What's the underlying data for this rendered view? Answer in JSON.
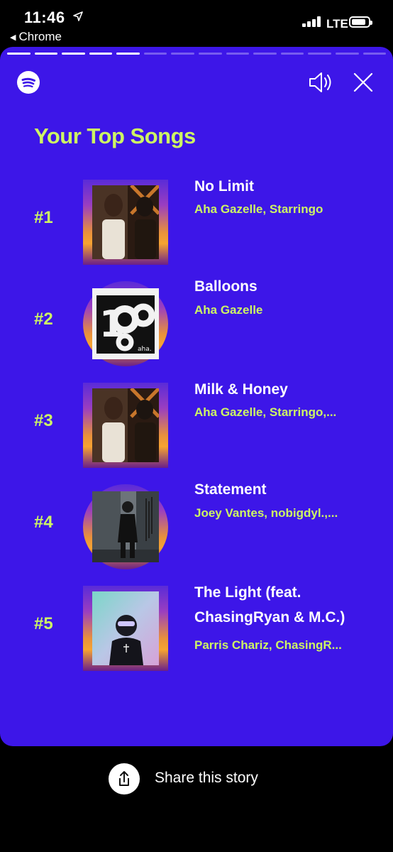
{
  "status_bar": {
    "time": "11:46",
    "back_app": "Chrome",
    "network": "LTE",
    "icons": [
      "location-arrow-icon",
      "signal-icon",
      "battery-icon"
    ]
  },
  "story": {
    "background": "#3d16e8",
    "accent": "#cdf564",
    "progress_segments_total": 14,
    "progress_segments_done": 5,
    "title": "Your Top Songs",
    "songs": [
      {
        "rank": "#1",
        "title": "No Limit",
        "artists": "Aha Gazelle, Starringo"
      },
      {
        "rank": "#2",
        "title": "Balloons",
        "artists": "Aha Gazelle"
      },
      {
        "rank": "#3",
        "title": "Milk & Honey",
        "artists": "Aha Gazelle, Starringo,..."
      },
      {
        "rank": "#4",
        "title": "Statement",
        "artists": "Joey Vantes, nobigdyl.,..."
      },
      {
        "rank": "#5",
        "title_line1": "The Light (feat.",
        "title_line2": "ChasingRyan & M.C.)",
        "artists": "Parris Chariz, ChasingR..."
      }
    ],
    "art_text": {
      "song2_label": "aha."
    }
  },
  "share": {
    "label": "Share this story",
    "icon": "share-icon"
  }
}
